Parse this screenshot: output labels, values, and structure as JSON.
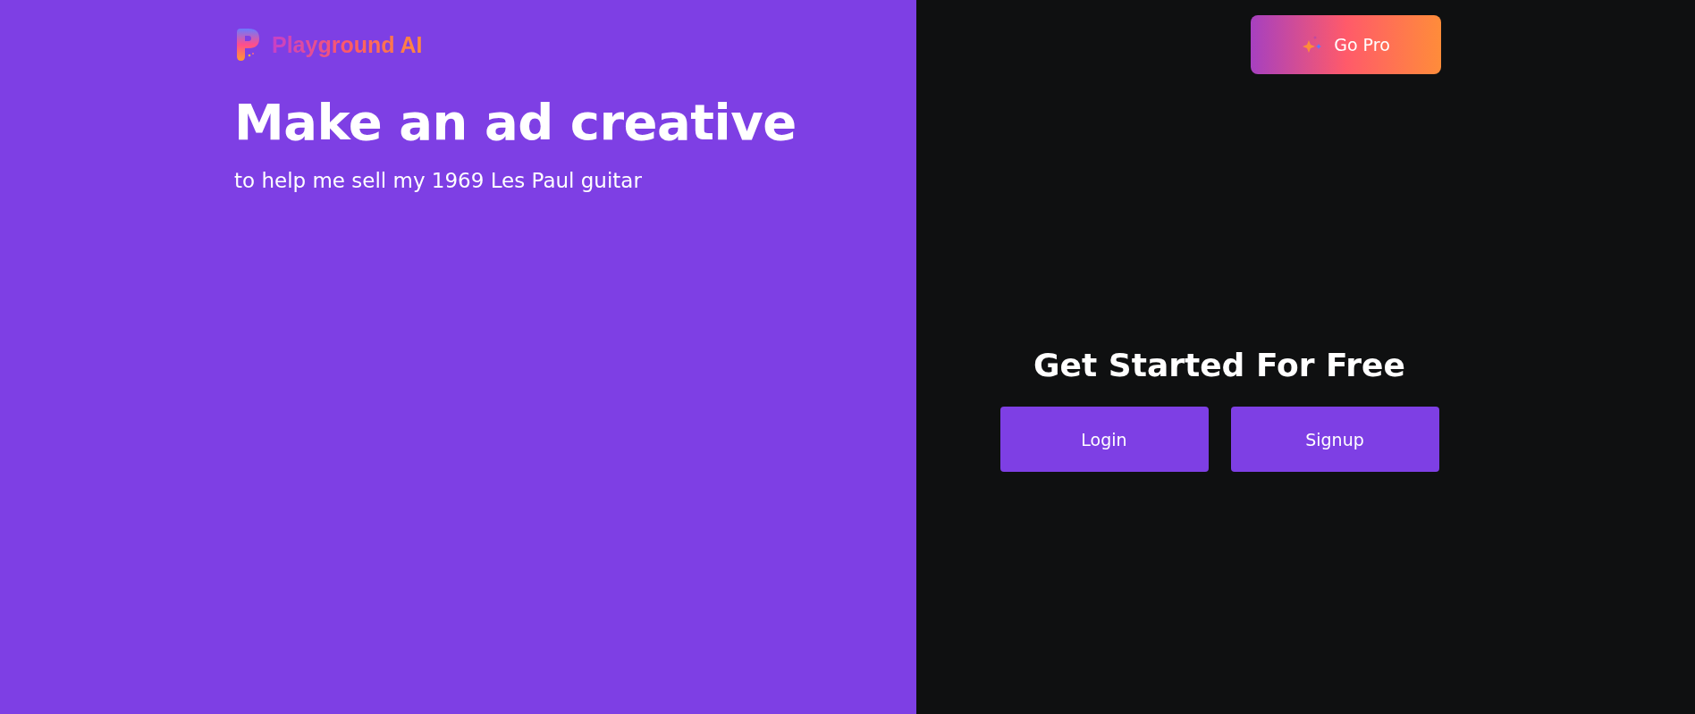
{
  "brand": {
    "name": "Playground AI"
  },
  "hero": {
    "title": "Make an ad creative",
    "subtitle": "to help me sell my 1969 Les Paul guitar"
  },
  "pro_button": {
    "label": "Go Pro"
  },
  "auth": {
    "heading": "Get Started For Free",
    "buttons": [
      "Login",
      "Signup"
    ]
  }
}
